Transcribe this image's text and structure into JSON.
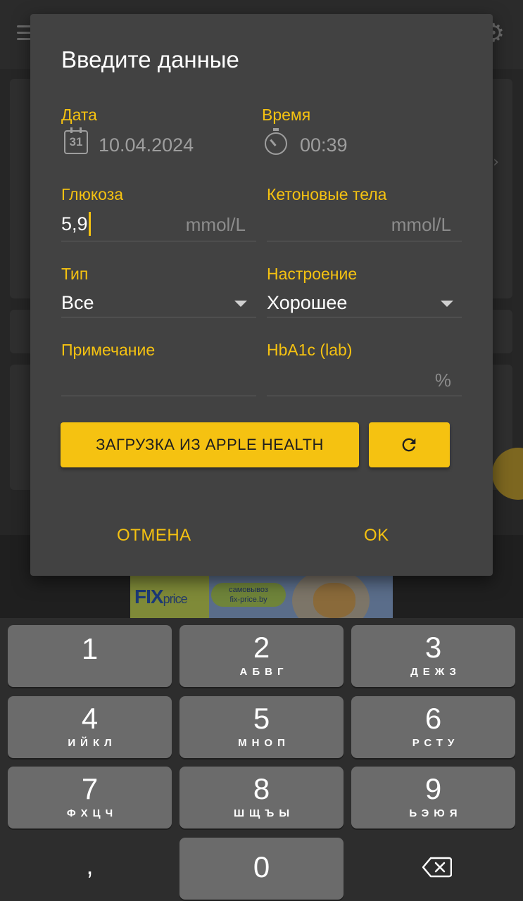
{
  "dialog": {
    "title": "Введите данные",
    "date": {
      "label": "Дата",
      "value": "10.04.2024",
      "icon": "calendar-icon",
      "icon_text": "31"
    },
    "time": {
      "label": "Время",
      "value": "00:39",
      "icon": "timer-icon"
    },
    "glucose": {
      "label": "Глюкоза",
      "value": "5,9",
      "unit": "mmol/L"
    },
    "ketones": {
      "label": "Кетоновые тела",
      "value": "",
      "unit": "mmol/L"
    },
    "type": {
      "label": "Тип",
      "value": "Все"
    },
    "mood": {
      "label": "Настроение",
      "value": "Хорошее"
    },
    "note": {
      "label": "Примечание",
      "value": ""
    },
    "hba1c": {
      "label": "HbA1c (lab)",
      "value": "",
      "unit": "%"
    },
    "import_button": "ЗАГРУЗКА ИЗ APPLE HEALTH",
    "refresh_icon": "refresh-icon",
    "cancel": "ОТМЕНА",
    "ok": "OK"
  },
  "ad": {
    "logo": "FIX",
    "logo_suffix": "price",
    "pill_line1": "самовывоз",
    "pill_line2": "fix-price.by"
  },
  "keypad": {
    "keys": [
      {
        "num": "1",
        "letters": ""
      },
      {
        "num": "2",
        "letters": "АБВГ"
      },
      {
        "num": "3",
        "letters": "ДЕЖЗ"
      },
      {
        "num": "4",
        "letters": "ИЙКЛ"
      },
      {
        "num": "5",
        "letters": "МНОП"
      },
      {
        "num": "6",
        "letters": "РСТУ"
      },
      {
        "num": "7",
        "letters": "ФХЦЧ"
      },
      {
        "num": "8",
        "letters": "ШЩЪЫ"
      },
      {
        "num": "9",
        "letters": "ЬЭЮЯ"
      }
    ],
    "comma": ",",
    "zero": "0",
    "backspace_icon": "backspace-icon"
  },
  "colors": {
    "accent": "#f5c211",
    "dialog_bg": "#424242",
    "key_bg": "#6b6b6b"
  }
}
